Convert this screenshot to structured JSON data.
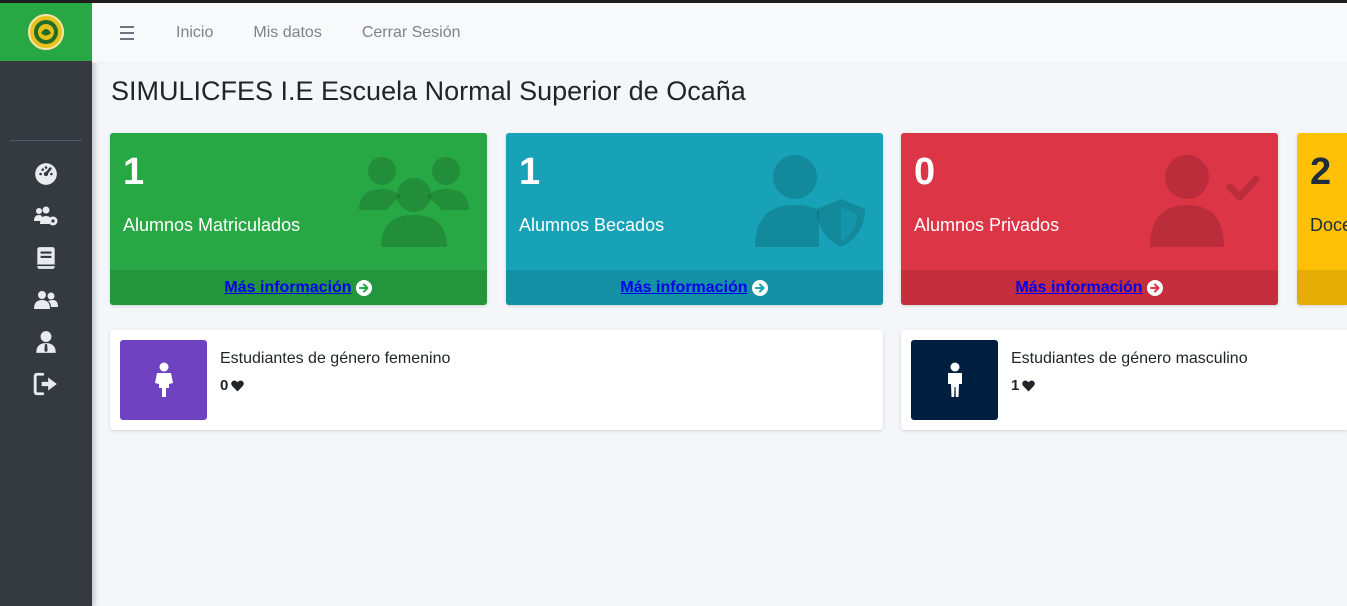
{
  "topbar": {
    "links": [
      "Inicio",
      "Mis datos",
      "Cerrar Sesión"
    ]
  },
  "page": {
    "title": "SIMULICFES I.E Escuela Normal Superior de Ocaña"
  },
  "stats": [
    {
      "value": "1",
      "label": "Alumnos Matriculados",
      "link": "Más información",
      "color": "#28a745",
      "icon": "users-icon"
    },
    {
      "value": "1",
      "label": "Alumnos Becados",
      "link": "Más información",
      "color": "#17a2b8",
      "icon": "user-shield-icon"
    },
    {
      "value": "0",
      "label": "Alumnos Privados",
      "link": "Más información",
      "color": "#dc3545",
      "icon": "user-check-icon"
    },
    {
      "value": "2",
      "label": "Doce",
      "color": "#ffc107"
    }
  ],
  "gender": [
    {
      "label": "Estudiantes de género femenino",
      "value": "0",
      "color": "#6f42c1",
      "icon": "female-icon"
    },
    {
      "label": "Estudiantes de género masculino",
      "value": "1",
      "color": "#001f3f",
      "icon": "male-icon"
    }
  ],
  "sidebar": {
    "items": [
      "dashboard-icon",
      "users-cog-icon",
      "book-icon",
      "users-icon",
      "user-tie-icon",
      "sign-out-icon"
    ]
  }
}
